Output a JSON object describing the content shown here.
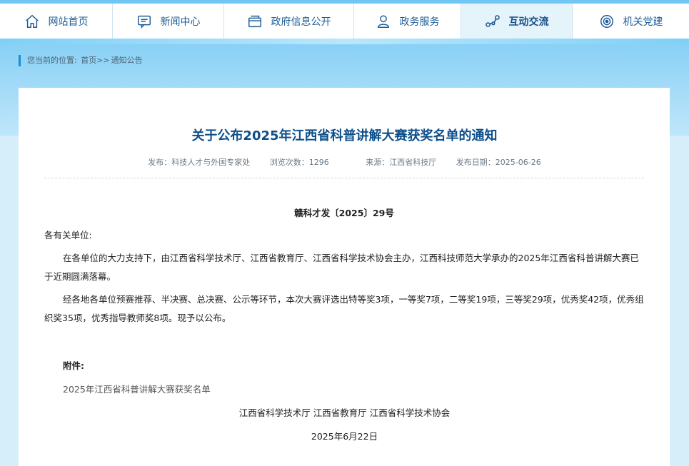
{
  "nav": {
    "items": [
      {
        "label": "网站首页",
        "icon": "home-icon"
      },
      {
        "label": "新闻中心",
        "icon": "chat-icon"
      },
      {
        "label": "政府信息公开",
        "icon": "folder-icon"
      },
      {
        "label": "政务服务",
        "icon": "user-icon"
      },
      {
        "label": "互动交流",
        "icon": "share-icon"
      },
      {
        "label": "机关党建",
        "icon": "badge-icon"
      }
    ],
    "active_index": 4
  },
  "breadcrumb": {
    "prefix": "您当前的位置:",
    "home": "首页",
    "sep": ">>",
    "current": "通知公告"
  },
  "article": {
    "title": "关于公布2025年江西省科普讲解大赛获奖名单的通知",
    "meta": {
      "publisher": "发布：科技人才与外国专家处",
      "views": "浏览次数：1296",
      "source": "来源：江西省科技厅",
      "date": "发布日期：2025-06-26"
    },
    "doc_no": "赣科才发〔2025〕29号",
    "salutation": "各有关单位:",
    "paragraph1": "在各单位的大力支持下，由江西省科学技术厅、江西省教育厅、江西省科学技术协会主办，江西科技师范大学承办的2025年江西省科普讲解大赛已于近期圆满落幕。",
    "paragraph2": "经各地各单位预赛推荐、半决赛、总决赛、公示等环节，本次大赛评选出特等奖3项，一等奖7项，二等奖19项，三等奖29项，优秀奖42项，优秀组织奖35项，优秀指导教师奖8项。现予以公布。",
    "attachment_label": "附件:",
    "attachment_link": "2025年江西省科普讲解大赛获奖名单",
    "signature": "江西省科学技术厅 江西省教育厅 江西省科学技术协会",
    "sign_date": "2025年6月22日"
  }
}
